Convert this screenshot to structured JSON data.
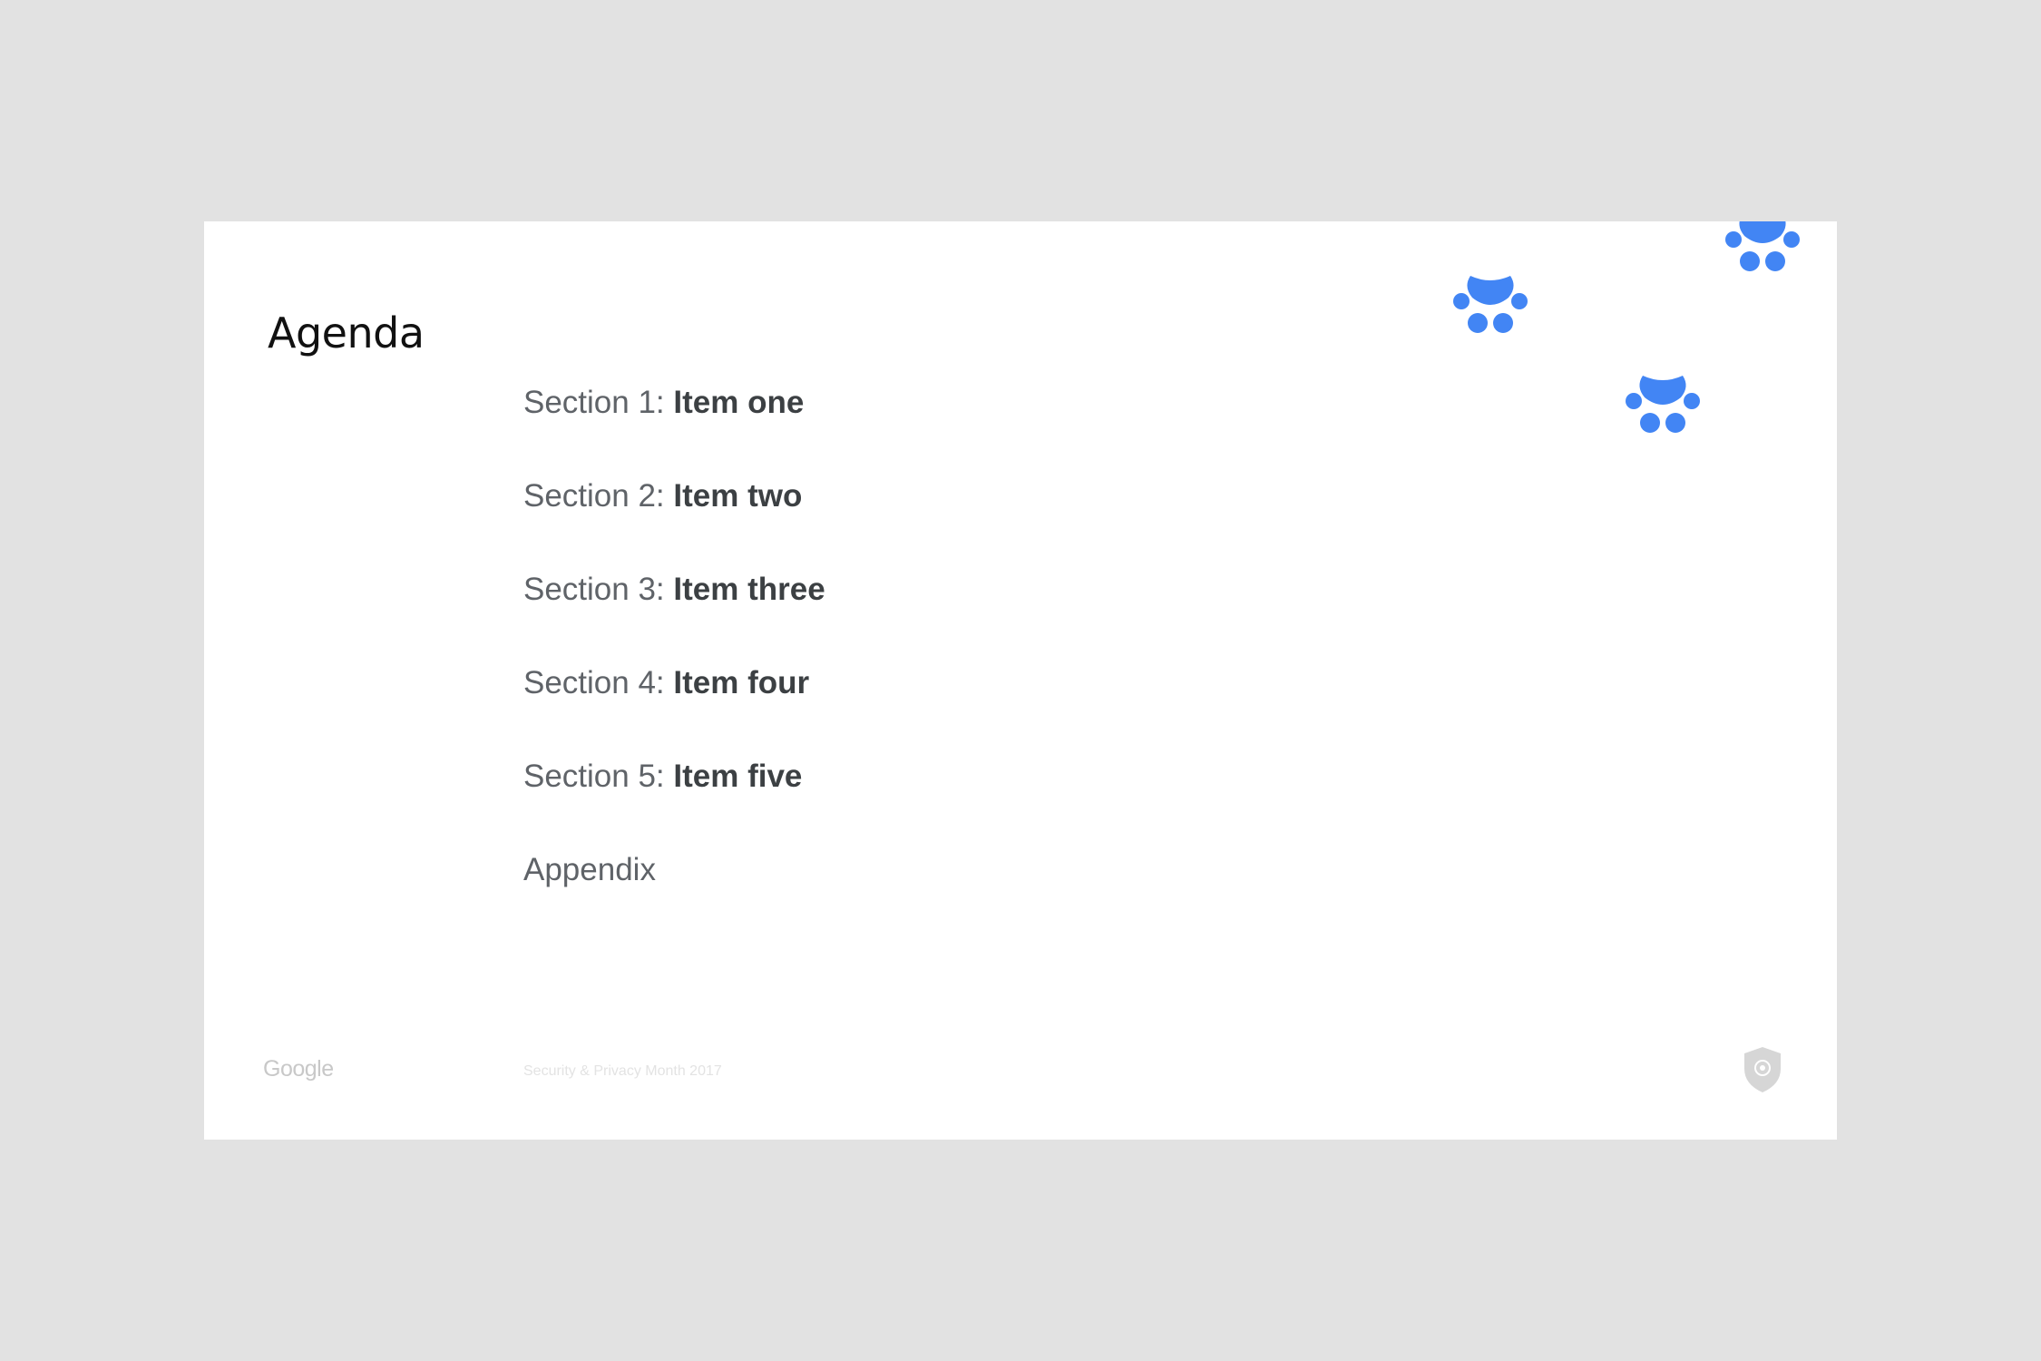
{
  "slide": {
    "title": "Agenda",
    "items": [
      {
        "prefix": "Section 1: ",
        "label": "Item one"
      },
      {
        "prefix": "Section 2: ",
        "label": "Item two"
      },
      {
        "prefix": "Section 3: ",
        "label": "Item three"
      },
      {
        "prefix": "Section 4: ",
        "label": "Item four"
      },
      {
        "prefix": "Section 5: ",
        "label": "Item five"
      },
      {
        "prefix": "Appendix",
        "label": ""
      }
    ],
    "footer": {
      "logo_text": "Google",
      "event_text": "Security & Privacy Month 2017"
    },
    "decorations": {
      "paw_icon": "paw-print-icon",
      "shield_icon": "shield-icon"
    },
    "colors": {
      "accent": "#4285f4",
      "background": "#e2e2e2",
      "slide": "#ffffff"
    }
  }
}
